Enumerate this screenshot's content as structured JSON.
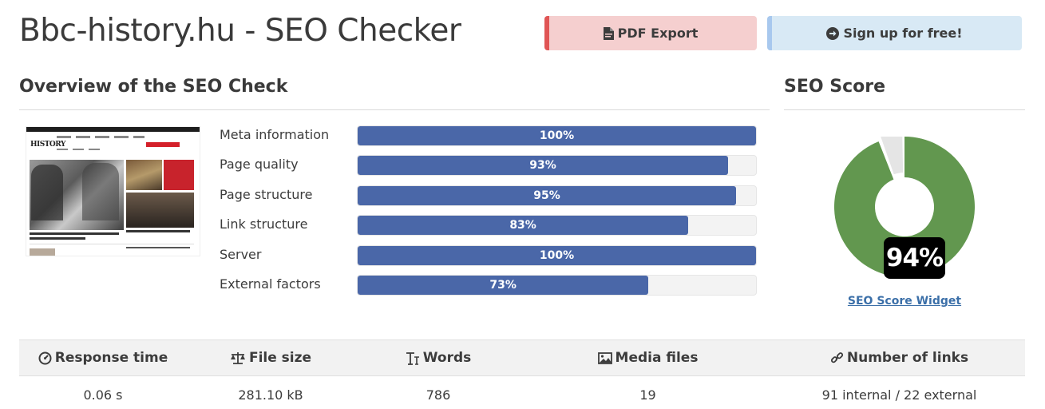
{
  "header": {
    "title": "Bbc-history.hu - SEO Checker",
    "pdf_export_label": "PDF Export",
    "signup_label": "Sign up for free!"
  },
  "overview": {
    "title": "Overview of the SEO Check",
    "bars": [
      {
        "label": "Meta information",
        "percent": 100,
        "text": "100%"
      },
      {
        "label": "Page quality",
        "percent": 93,
        "text": "93%"
      },
      {
        "label": "Page structure",
        "percent": 95,
        "text": "95%"
      },
      {
        "label": "Link structure",
        "percent": 83,
        "text": "83%"
      },
      {
        "label": "Server",
        "percent": 100,
        "text": "100%"
      },
      {
        "label": "External factors",
        "percent": 73,
        "text": "73%"
      }
    ]
  },
  "score": {
    "title": "SEO Score",
    "value": 94,
    "text": "94%",
    "widget_link": "SEO Score Widget",
    "colors": {
      "good": "#62974f",
      "rest": "#e5e5e5",
      "bar": "#4a67a8"
    }
  },
  "stats": [
    {
      "title": "Response time",
      "icon": "gauge-icon",
      "value": "0.06 s"
    },
    {
      "title": "File size",
      "icon": "scale-icon",
      "value": "281.10 kB"
    },
    {
      "title": "Words",
      "icon": "text-height-icon",
      "value": "786"
    },
    {
      "title": "Media files",
      "icon": "image-icon",
      "value": "19"
    },
    {
      "title": "Number of links",
      "icon": "link-icon",
      "value": "91 internal / 22 external"
    }
  ]
}
